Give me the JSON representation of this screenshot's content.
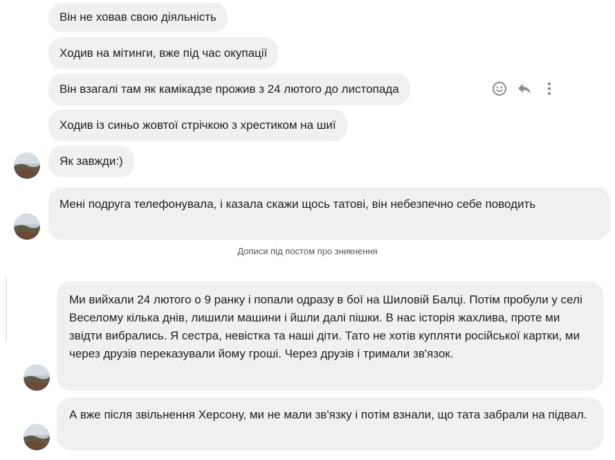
{
  "messages": [
    {
      "text": "Він не ховав свою діяльність"
    },
    {
      "text": "Ходив на мітинги, вже під час окупації"
    },
    {
      "text": "Він взагалі там як камікадзе прожив з 24 лютого до листопада"
    },
    {
      "text": "Ходив із синьо жовтої стрічкою з хрестиком на шиї"
    },
    {
      "text": "Як завжди:)"
    },
    {
      "text": "Мені подруга телефонувала, і казала скажи щось татові, він небезпечно себе поводить"
    }
  ],
  "caption": "Дописи під постом про зникнення",
  "messages2": [
    {
      "text": "Ми вийхали 24 лютого о 9 ранку і попали одразу в бої на Шиловій Балці. Потім пробули у селі Веселому кілька днів, лишили машини і йшли далі пішки. В нас історія жахлива, проте ми звідти вибрались. Я сестра, невістка та наші діти. Тато не хотів купляти російської картки, ми через друзів переказували йому гроші. Через друзів і тримали зв'язок."
    },
    {
      "text": "А вже після звільнення Херсону, ми не мали зв'язку і потім взнали, що тата забрали на підвал."
    }
  ],
  "hover_actions": [
    "smiley-icon",
    "reply-icon",
    "more-icon"
  ]
}
